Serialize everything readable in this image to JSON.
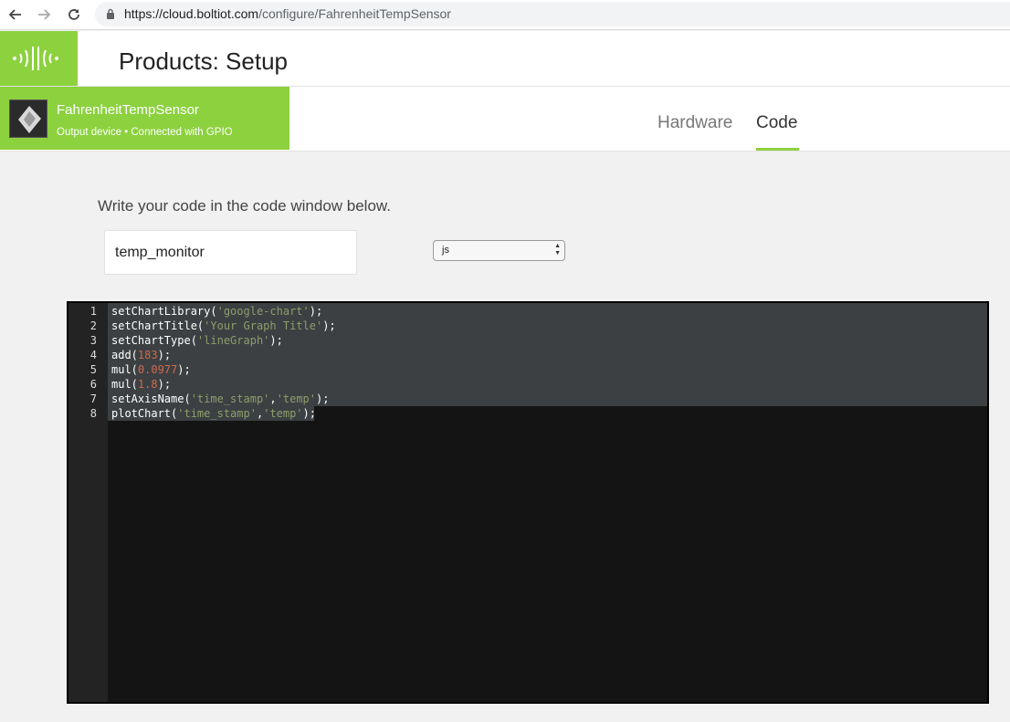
{
  "browser": {
    "url_host": "https://cloud.boltiot.com",
    "url_path": "/configure/FahrenheitTempSensor"
  },
  "header": {
    "title": "Products: Setup"
  },
  "device": {
    "name": "FahrenheitTempSensor",
    "status": "Output device • Connected with GPIO"
  },
  "tabs": [
    {
      "label": "Hardware",
      "active": false
    },
    {
      "label": "Code",
      "active": true
    }
  ],
  "main": {
    "instruction": "Write your code in the code window below.",
    "file_name": "temp_monitor",
    "language": "js"
  },
  "editor": {
    "lines": [
      {
        "num": "1",
        "parts": [
          [
            "t",
            "setChartLibrary("
          ],
          [
            "s",
            "'google-chart'"
          ],
          [
            "t",
            ");"
          ]
        ]
      },
      {
        "num": "2",
        "parts": [
          [
            "t",
            "setChartTitle("
          ],
          [
            "s",
            "'Your Graph Title'"
          ],
          [
            "t",
            ");"
          ]
        ]
      },
      {
        "num": "3",
        "parts": [
          [
            "t",
            "setChartType("
          ],
          [
            "s",
            "'lineGraph'"
          ],
          [
            "t",
            ");"
          ]
        ]
      },
      {
        "num": "4",
        "parts": [
          [
            "t",
            "add("
          ],
          [
            "n",
            "183"
          ],
          [
            "t",
            ");"
          ]
        ]
      },
      {
        "num": "5",
        "parts": [
          [
            "t",
            "mul("
          ],
          [
            "n",
            "0.0977"
          ],
          [
            "t",
            ");"
          ]
        ]
      },
      {
        "num": "6",
        "parts": [
          [
            "t",
            "mul("
          ],
          [
            "n",
            "1.8"
          ],
          [
            "t",
            ");"
          ]
        ]
      },
      {
        "num": "7",
        "parts": [
          [
            "t",
            "setAxisName("
          ],
          [
            "s",
            "'time_stamp'"
          ],
          [
            "t",
            ","
          ],
          [
            "s",
            "'temp'"
          ],
          [
            "t",
            ");"
          ]
        ]
      },
      {
        "num": "8",
        "parts": [
          [
            "t",
            "plotChart("
          ],
          [
            "s",
            "'time_stamp'"
          ],
          [
            "t",
            ","
          ],
          [
            "s",
            "'temp'"
          ],
          [
            "t",
            ");"
          ]
        ]
      }
    ]
  },
  "colors": {
    "brand_green": "#8cd13e",
    "editor_bg": "#141414",
    "string": "#8f9d6a",
    "number": "#cf6a4c"
  }
}
